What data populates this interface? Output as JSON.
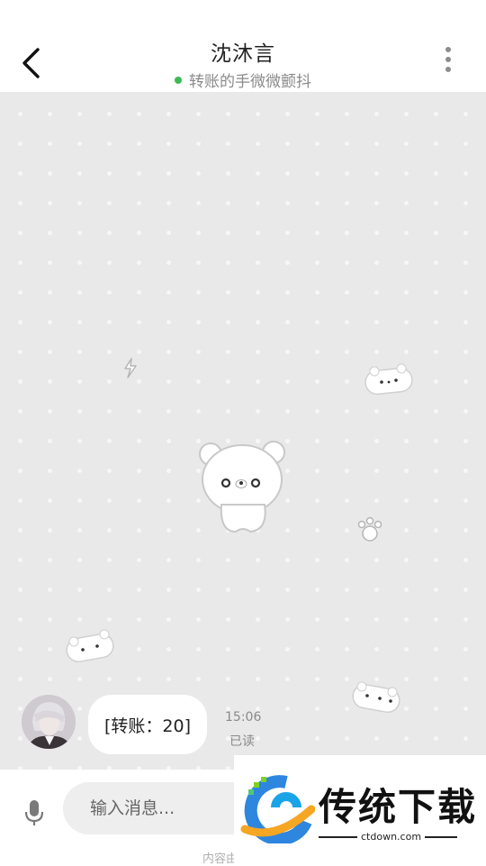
{
  "header": {
    "contact_name": "沈沐言",
    "status_text": "转账的手微微颤抖",
    "status_color": "#3dba52",
    "back_icon": "chevron-left-icon",
    "more_icon": "more-vertical-icon"
  },
  "chat": {
    "messages": [
      {
        "sender": "contact",
        "text": "[转账：20]",
        "time": "15:06",
        "read_status": "已读"
      }
    ]
  },
  "input_bar": {
    "mic_icon": "microphone-icon",
    "placeholder": "输入消息...",
    "value": "",
    "footnote": "内容由"
  },
  "watermark": {
    "brand": "传统下载",
    "url": "ctdown.com"
  }
}
